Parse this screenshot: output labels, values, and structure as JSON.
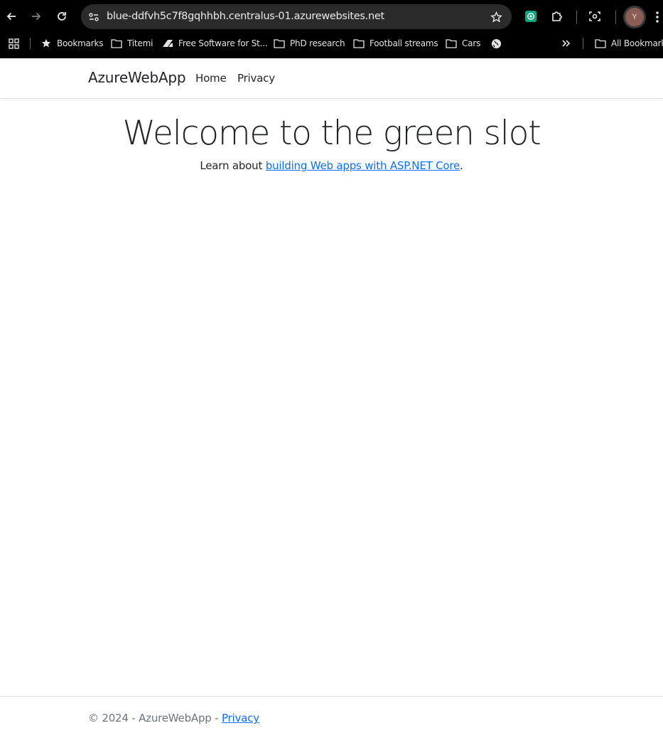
{
  "browser": {
    "url": "blue-ddfvh5c7f8gqhhbh.centralus-01.azurewebsites.net",
    "avatar_initial": "Y",
    "bookmarks": [
      {
        "label": "Bookmarks",
        "icon": "star-icon"
      },
      {
        "label": "Titemi",
        "icon": "folder-icon"
      },
      {
        "label": "Free Software for St...",
        "icon": "site-icon"
      },
      {
        "label": "PhD research",
        "icon": "folder-icon"
      },
      {
        "label": "Football streams",
        "icon": "folder-icon"
      },
      {
        "label": "Cars",
        "icon": "folder-icon"
      }
    ],
    "all_bookmarks": "All Bookmarks"
  },
  "site": {
    "brand": "AzureWebApp",
    "nav": [
      {
        "label": "Home"
      },
      {
        "label": "Privacy"
      }
    ],
    "heading": "Welcome to the green slot",
    "lead_prefix": "Learn about ",
    "lead_link": "building Web apps with ASP.NET Core",
    "lead_suffix": ".",
    "footer_text": "© 2024 - AzureWebApp - ",
    "footer_link": "Privacy"
  },
  "colors": {
    "link": "#0d6efd",
    "text": "#212529",
    "muted": "#6c757d",
    "chrome_bg": "#000000"
  }
}
